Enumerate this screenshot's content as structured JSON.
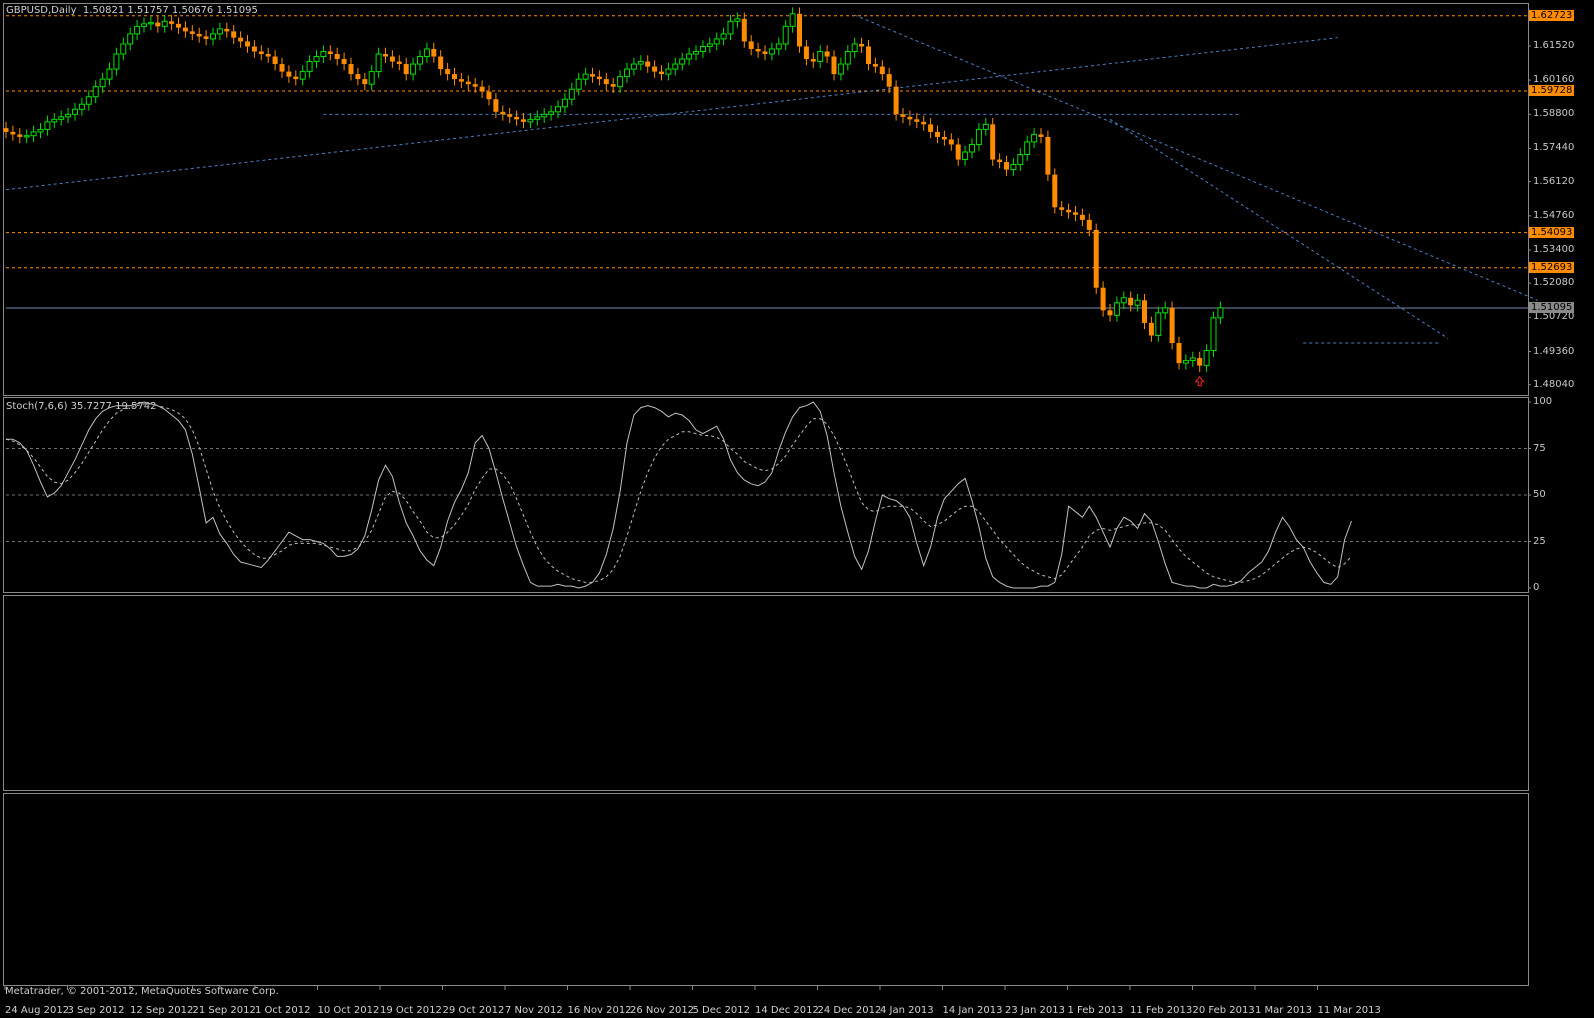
{
  "header": {
    "symbol": "GBPUSD,Daily",
    "ohlc": "1.50821 1.51757 1.50676 1.51095"
  },
  "stoch_header": "Stoch(7,6,6) 35.7277 19.5742",
  "footer": "Metatrader, © 2001-2012, MetaQuotes Software Corp.",
  "colors": {
    "background": "#000000",
    "bull": "#00e000",
    "bear": "#ff8c00",
    "level_line": "#ff8c00",
    "trend_line": "#4a7fc0",
    "bid_line": "#7a8aa8",
    "stoch_main": "#c0c0c0",
    "stoch_signal": "#c0c0c0",
    "arrow": "#ff2020"
  },
  "price_axis": {
    "min": 1.4775,
    "max": 1.6315,
    "ticks": [
      "1.61520",
      "1.60160",
      "1.58800",
      "1.57440",
      "1.56120",
      "1.54760",
      "1.53400",
      "1.52080",
      "1.50720",
      "1.49360",
      "1.48040"
    ],
    "level_tags": [
      "1.62723",
      "1.59728",
      "1.54093",
      "1.52693"
    ],
    "current_tag": "1.51095"
  },
  "stoch_axis": {
    "ticks": [
      "100",
      "75",
      "50",
      "25",
      "0"
    ]
  },
  "date_labels": [
    "24 Aug 2012",
    "3 Sep 2012",
    "12 Sep 2012",
    "21 Sep 2012",
    "1 Oct 2012",
    "10 Oct 2012",
    "19 Oct 2012",
    "29 Oct 2012",
    "7 Nov 2012",
    "16 Nov 2012",
    "26 Nov 2012",
    "5 Dec 2012",
    "14 Dec 2012",
    "24 Dec 2012",
    "4 Jan 2013",
    "14 Jan 2013",
    "23 Jan 2013",
    "1 Feb 2013",
    "11 Feb 2013",
    "20 Feb 2013",
    "1 Mar 2013",
    "11 Mar 2013"
  ],
  "chart_data": {
    "type": "candlestick",
    "title": "GBPUSD,Daily",
    "levels": [
      1.62723,
      1.59728,
      1.54093,
      1.52693
    ],
    "current_price": 1.51095,
    "trendlines": [
      {
        "from": [
          0,
          1.558
        ],
        "to": [
          193,
          1.6185
        ]
      },
      {
        "from": [
          123,
          1.6275
        ],
        "to": [
          222,
          1.514
        ]
      },
      {
        "from": [
          160,
          1.586
        ],
        "to": [
          209,
          1.4988
        ]
      },
      {
        "from": [
          46,
          1.588
        ],
        "to": [
          179,
          1.588
        ]
      },
      {
        "from": [
          188,
          1.497
        ],
        "to": [
          208,
          1.497
        ]
      }
    ],
    "closes": [
      1.581,
      1.58,
      1.579,
      1.5795,
      1.581,
      1.582,
      1.585,
      1.586,
      1.587,
      1.588,
      1.59,
      1.592,
      1.595,
      1.599,
      1.602,
      1.606,
      1.612,
      1.616,
      1.62,
      1.623,
      1.624,
      1.6245,
      1.623,
      1.625,
      1.624,
      1.6225,
      1.621,
      1.62,
      1.619,
      1.618,
      1.62,
      1.622,
      1.621,
      1.6185,
      1.617,
      1.615,
      1.613,
      1.612,
      1.611,
      1.608,
      1.605,
      1.603,
      1.602,
      1.605,
      1.609,
      1.611,
      1.613,
      1.612,
      1.61,
      1.608,
      1.604,
      1.602,
      1.6,
      1.605,
      1.612,
      1.611,
      1.609,
      1.608,
      1.604,
      1.608,
      1.611,
      1.614,
      1.611,
      1.606,
      1.604,
      1.602,
      1.601,
      1.6,
      1.599,
      1.597,
      1.594,
      1.589,
      1.588,
      1.587,
      1.586,
      1.585,
      1.586,
      1.587,
      1.588,
      1.589,
      1.591,
      1.594,
      1.598,
      1.602,
      1.604,
      1.603,
      1.602,
      1.6,
      1.599,
      1.603,
      1.606,
      1.608,
      1.609,
      1.607,
      1.605,
      1.604,
      1.606,
      1.608,
      1.61,
      1.612,
      1.613,
      1.615,
      1.616,
      1.618,
      1.62,
      1.625,
      1.626,
      1.617,
      1.614,
      1.613,
      1.612,
      1.614,
      1.616,
      1.623,
      1.628,
      1.615,
      1.61,
      1.609,
      1.613,
      1.611,
      1.604,
      1.608,
      1.613,
      1.616,
      1.615,
      1.608,
      1.607,
      1.604,
      1.599,
      1.588,
      1.587,
      1.586,
      1.585,
      1.584,
      1.581,
      1.579,
      1.578,
      1.576,
      1.57,
      1.573,
      1.576,
      1.582,
      1.584,
      1.57,
      1.569,
      1.566,
      1.568,
      1.572,
      1.577,
      1.58,
      1.579,
      1.564,
      1.551,
      1.55,
      1.549,
      1.548,
      1.546,
      1.542,
      1.519,
      1.51,
      1.508,
      1.513,
      1.515,
      1.512,
      1.514,
      1.505,
      1.5,
      1.509,
      1.511,
      1.497,
      1.489,
      1.49,
      1.491,
      1.488,
      1.494,
      1.507,
      1.511
    ],
    "stoch_main": [
      80,
      80,
      78,
      74,
      66,
      57,
      49,
      51,
      55,
      62,
      69,
      77,
      85,
      91,
      95,
      97,
      98,
      98,
      98,
      99,
      100,
      99,
      98,
      96,
      93,
      90,
      85,
      72,
      54,
      35,
      38,
      29,
      24,
      18,
      14,
      13,
      12,
      11,
      15,
      20,
      25,
      30,
      28,
      26,
      26,
      25,
      24,
      21,
      17,
      17,
      18,
      21,
      28,
      42,
      58,
      66,
      60,
      46,
      35,
      28,
      20,
      15,
      12,
      22,
      36,
      46,
      53,
      62,
      78,
      82,
      75,
      62,
      48,
      35,
      22,
      12,
      3,
      1,
      1,
      1,
      2,
      1,
      1,
      0,
      1,
      3,
      8,
      18,
      32,
      52,
      78,
      93,
      97,
      98,
      97,
      95,
      92,
      94,
      93,
      90,
      85,
      83,
      85,
      87,
      80,
      69,
      62,
      58,
      56,
      55,
      57,
      62,
      74,
      84,
      92,
      97,
      98,
      100,
      95,
      82,
      62,
      44,
      30,
      17,
      10,
      20,
      36,
      50,
      48,
      47,
      44,
      38,
      24,
      12,
      22,
      38,
      48,
      52,
      56,
      59,
      47,
      33,
      16,
      6,
      3,
      1,
      0,
      0,
      0,
      0,
      1,
      1,
      3,
      18,
      44,
      41,
      38,
      44,
      38,
      30,
      22,
      32,
      38,
      36,
      32,
      40,
      36,
      25,
      13,
      3,
      2,
      1,
      1,
      0,
      0,
      2,
      1,
      1,
      2,
      4,
      8,
      11,
      14,
      20,
      30,
      38,
      33,
      26,
      22,
      14,
      8,
      3,
      2,
      6,
      26,
      36
    ],
    "stoch_signal": [
      80,
      79,
      77,
      74,
      70,
      65,
      60,
      57,
      56,
      58,
      62,
      67,
      73,
      79,
      85,
      90,
      94,
      96,
      97,
      98,
      99,
      99,
      98,
      97,
      96,
      94,
      91,
      85,
      76,
      64,
      52,
      43,
      36,
      30,
      25,
      21,
      18,
      16,
      16,
      18,
      20,
      23,
      24,
      24,
      24,
      24,
      23,
      22,
      21,
      20,
      20,
      22,
      25,
      31,
      40,
      49,
      52,
      51,
      47,
      41,
      36,
      30,
      27,
      27,
      30,
      34,
      39,
      45,
      53,
      59,
      64,
      64,
      61,
      56,
      48,
      39,
      30,
      22,
      16,
      12,
      9,
      7,
      5,
      4,
      3,
      3,
      4,
      6,
      10,
      17,
      28,
      40,
      52,
      62,
      70,
      76,
      80,
      82,
      84,
      84,
      83,
      82,
      82,
      81,
      79,
      75,
      72,
      68,
      66,
      64,
      63,
      64,
      67,
      71,
      77,
      82,
      87,
      91,
      91,
      88,
      82,
      74,
      65,
      55,
      46,
      42,
      41,
      43,
      44,
      44,
      44,
      43,
      40,
      36,
      33,
      34,
      36,
      39,
      42,
      44,
      44,
      41,
      36,
      31,
      26,
      22,
      18,
      14,
      11,
      9,
      7,
      6,
      5,
      7,
      12,
      17,
      22,
      28,
      31,
      32,
      31,
      32,
      33,
      34,
      34,
      35,
      35,
      34,
      31,
      26,
      21,
      17,
      14,
      11,
      8,
      6,
      5,
      4,
      3,
      3,
      4,
      5,
      7,
      10,
      13,
      16,
      19,
      21,
      22,
      21,
      19,
      16,
      13,
      11,
      13,
      17
    ]
  }
}
